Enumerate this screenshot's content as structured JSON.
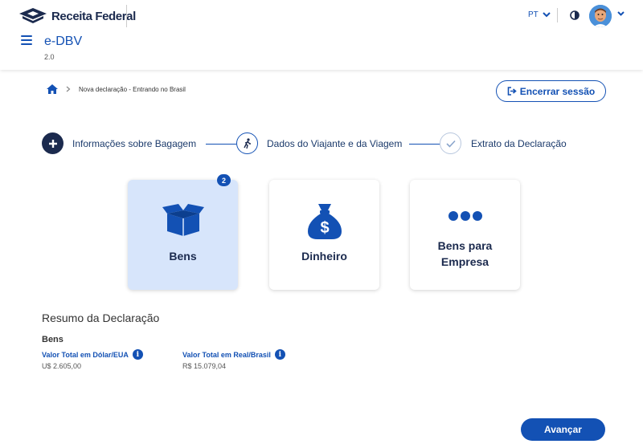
{
  "header": {
    "logo_text": "Receita Federal",
    "app_title": "e-DBV",
    "app_version": "2.0",
    "language": "PT",
    "icons": [
      "menu-icon",
      "chevron-down-icon",
      "contrast-icon",
      "user-avatar"
    ]
  },
  "breadcrumb": {
    "current": "Nova declaração - Entrando no Brasil"
  },
  "actions": {
    "end_session": "Encerrar sessão",
    "next": "Avançar"
  },
  "steps": [
    {
      "label": "Informações sobre Bagagem",
      "state": "active"
    },
    {
      "label": "Dados do Viajante e da Viagem",
      "state": "pending"
    },
    {
      "label": "Extrato da Declaração",
      "state": "pending"
    }
  ],
  "cards": [
    {
      "label": "Bens",
      "badge": "2",
      "selected": true,
      "icon": "open-box-icon"
    },
    {
      "label": "Dinheiro",
      "selected": false,
      "icon": "money-bag-icon"
    },
    {
      "label_line1": "Bens para",
      "label_line2": "Empresa",
      "selected": false,
      "icon": "more-dots-icon"
    }
  ],
  "summary": {
    "title": "Resumo da Declaração",
    "section": "Bens",
    "usd_label": "Valor Total em Dólar/EUA",
    "usd_value": "U$ 2.605,00",
    "brl_label": "Valor Total em Real/Brasil",
    "brl_value": "R$ 15.079,04"
  },
  "colors": {
    "primary": "#1351b4",
    "dark_navy": "#1b2a4e",
    "selected_card": "#d7e5fb"
  }
}
